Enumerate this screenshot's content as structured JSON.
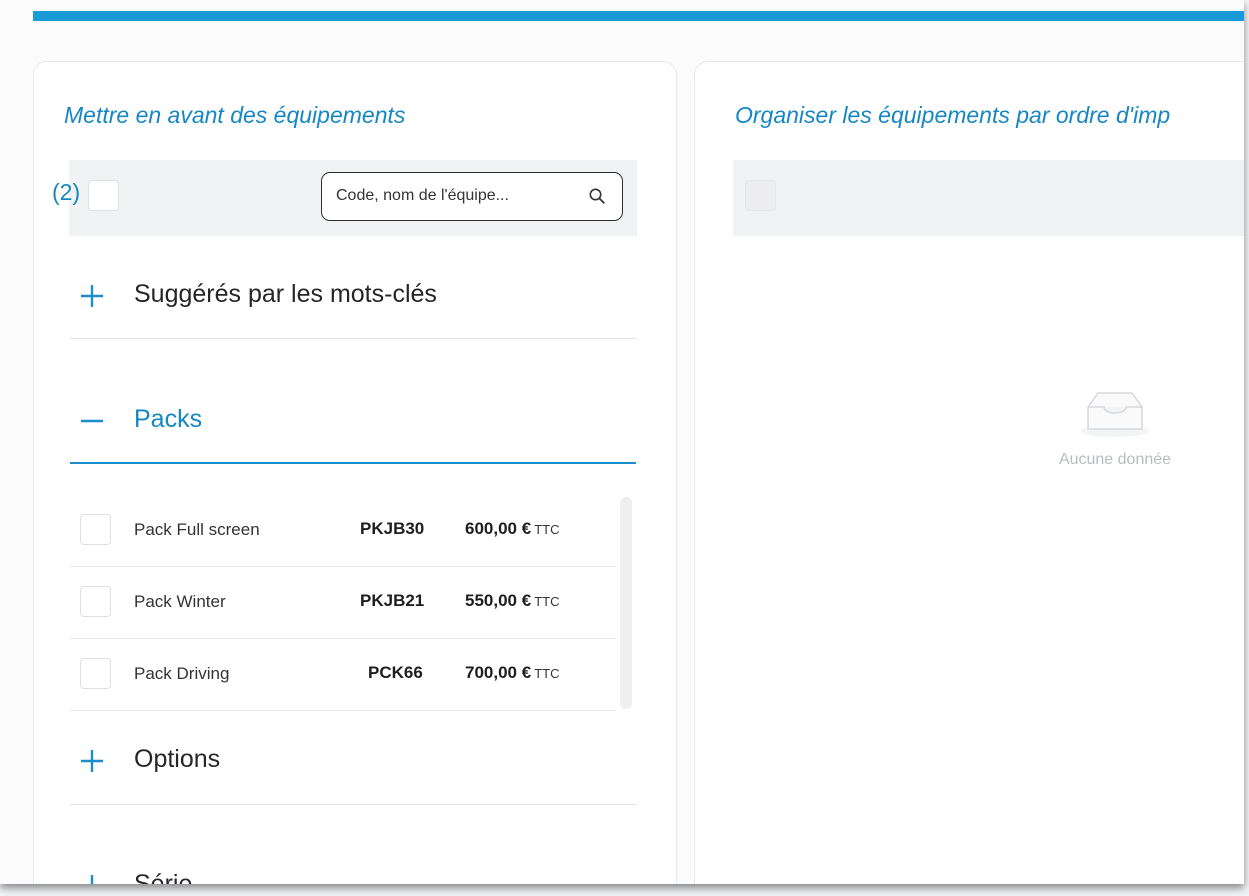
{
  "colors": {
    "accent": "#1a9bd7",
    "title_text": "#1787c3",
    "panel_bg": "#ffffff",
    "strip_bg": "#f1f2f3"
  },
  "left_panel": {
    "title": "Mettre en avant des équipements",
    "selection_count": "(2)",
    "search": {
      "placeholder": "Code, nom de l'équipe...",
      "icon": "search-icon"
    },
    "sections": [
      {
        "label": "Suggérés par les mots-clés",
        "state": "collapsed",
        "icon": "plus-icon"
      },
      {
        "label": "Packs",
        "state": "expanded",
        "icon": "minus-icon"
      },
      {
        "label": "Options",
        "state": "collapsed",
        "icon": "plus-icon"
      },
      {
        "label": "Série",
        "state": "collapsed",
        "icon": "plus-icon"
      }
    ],
    "packs": [
      {
        "name": "Pack Full screen",
        "code": "PKJB30",
        "price": "600,00 €",
        "tax": "TTC",
        "checked": false
      },
      {
        "name": "Pack Winter",
        "code": "PKJB21",
        "price": "550,00 €",
        "tax": "TTC",
        "checked": false
      },
      {
        "name": "Pack Driving",
        "code": "PCK66",
        "price": "700,00 €",
        "tax": "TTC",
        "checked": false
      }
    ]
  },
  "right_panel": {
    "title": "Organiser les équipements par ordre d'imp",
    "empty_icon": "inbox-icon",
    "empty_text": "Aucune donnée"
  }
}
